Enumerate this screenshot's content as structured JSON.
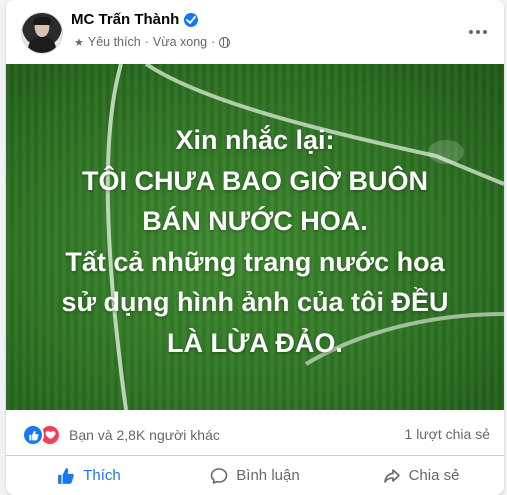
{
  "post": {
    "author": "MC Trấn Thành",
    "meta": {
      "label": "Yêu thích",
      "separator": "·",
      "time": "Vừa xong"
    },
    "image_text": [
      "Xin nhắc lại:",
      "TÔI CHƯA BAO GIỜ BUÔN",
      "BÁN NƯỚC HOA.",
      "Tất cả những trang nước hoa",
      "sử dụng hình ảnh của tôi ĐỀU",
      "LÀ LỪA ĐẢO."
    ],
    "stats": {
      "reactions_text": "Bạn và 2,8K người khác",
      "shares_text": "1 lượt chia sẻ"
    },
    "actions": {
      "like": "Thích",
      "comment": "Bình luận",
      "share": "Chia sẻ"
    }
  },
  "colors": {
    "accent": "#1877f2",
    "text_secondary": "#65676b",
    "love": "#f33e58"
  },
  "icons": [
    "verified-badge-icon",
    "star-icon",
    "globe-icon",
    "more-icon",
    "like-reaction-icon",
    "love-reaction-icon",
    "thumbs-up-icon",
    "comment-icon",
    "share-icon"
  ]
}
